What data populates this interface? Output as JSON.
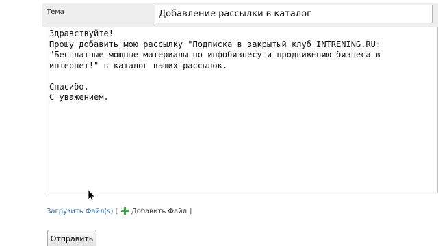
{
  "form": {
    "subject_label": "Тема",
    "subject_value": "Добавление рассылки в каталог",
    "message": "Здравствуйте!\nПрошу добавить мою рассылку \"Подписка в закрытый клуб INTRENING.RU:\n\"Бесплатные мощные материалы по инфобизнесу и продвижению бизнеса в\nинтернет!\" в каталог ваших рассылок.\n\nСпасибо.\nС уважением.",
    "upload_link": "Загрузить Файл(s)",
    "bracket_open": "[",
    "add_file_label": "Добавить Файл",
    "bracket_close": "]",
    "submit_label": "Отправить"
  },
  "icons": {
    "add_file": "plus-icon",
    "mouse": "mouse-cursor-icon"
  },
  "colors": {
    "link": "#2f6fb3",
    "plus_green": "#39a845",
    "row_background": "#eeeeee"
  }
}
